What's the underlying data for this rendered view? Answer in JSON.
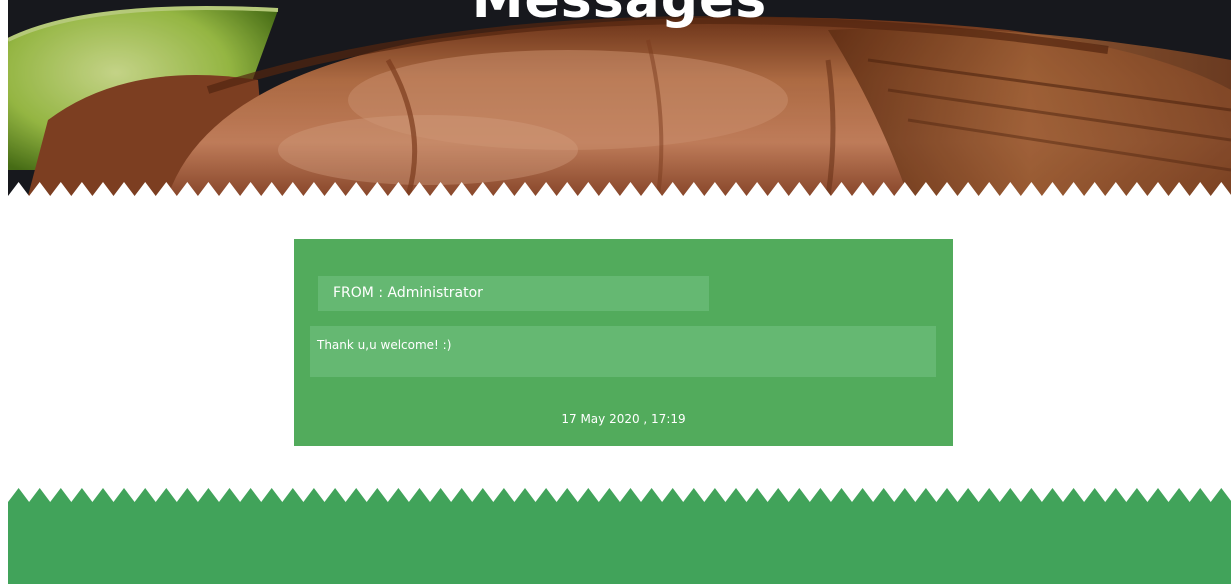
{
  "hero": {
    "title": "Messages",
    "image": "grilled-salmon-with-lime"
  },
  "message": {
    "from_label": "FROM :",
    "from_name": "Administrator",
    "body": "Thank u,u welcome! :)",
    "timestamp": "17 May 2020 , 17:19"
  },
  "colors": {
    "card": "#52ab5c",
    "card_field": "#65b872",
    "footer": "#41a35a",
    "text": "#ffffff"
  }
}
